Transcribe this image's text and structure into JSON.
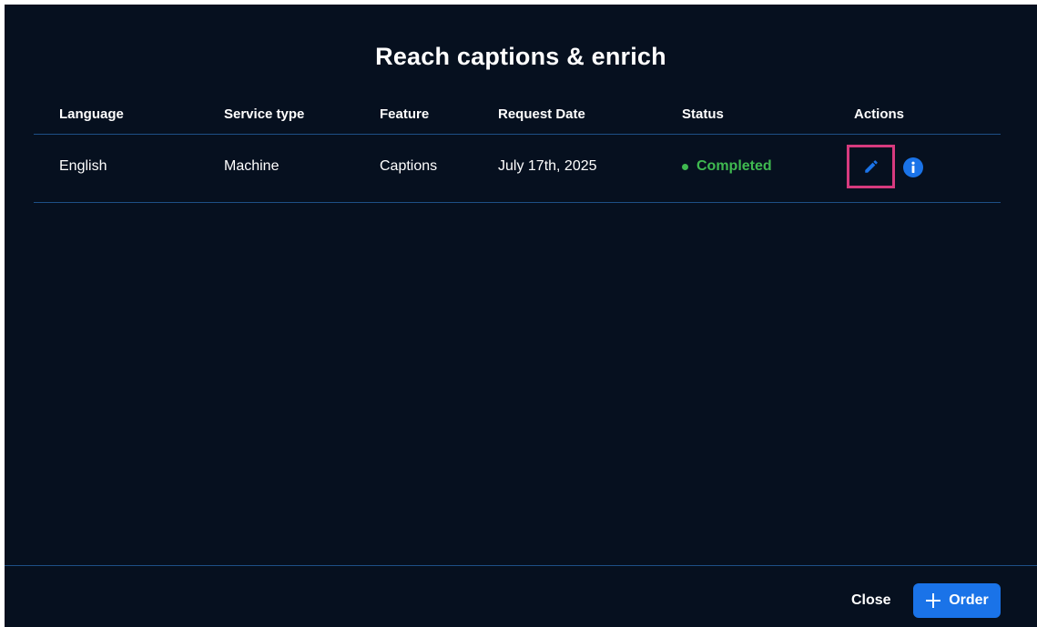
{
  "dialog": {
    "title": "Reach captions & enrich"
  },
  "table": {
    "headers": {
      "language": "Language",
      "service_type": "Service type",
      "feature": "Feature",
      "request_date": "Request Date",
      "status": "Status",
      "actions": "Actions"
    },
    "rows": [
      {
        "language": "English",
        "service_type": "Machine",
        "feature": "Captions",
        "request_date": "July 17th, 2025",
        "status": "Completed"
      }
    ]
  },
  "footer": {
    "close_label": "Close",
    "order_label": "Order"
  },
  "icons": {
    "edit": "pencil-icon",
    "info": "info-icon",
    "order": "plus-icon"
  },
  "colors": {
    "background": "#06101f",
    "divider": "#1d4f86",
    "status_completed": "#3fb950",
    "accent": "#1a73e8",
    "highlight": "#d63a7e"
  }
}
